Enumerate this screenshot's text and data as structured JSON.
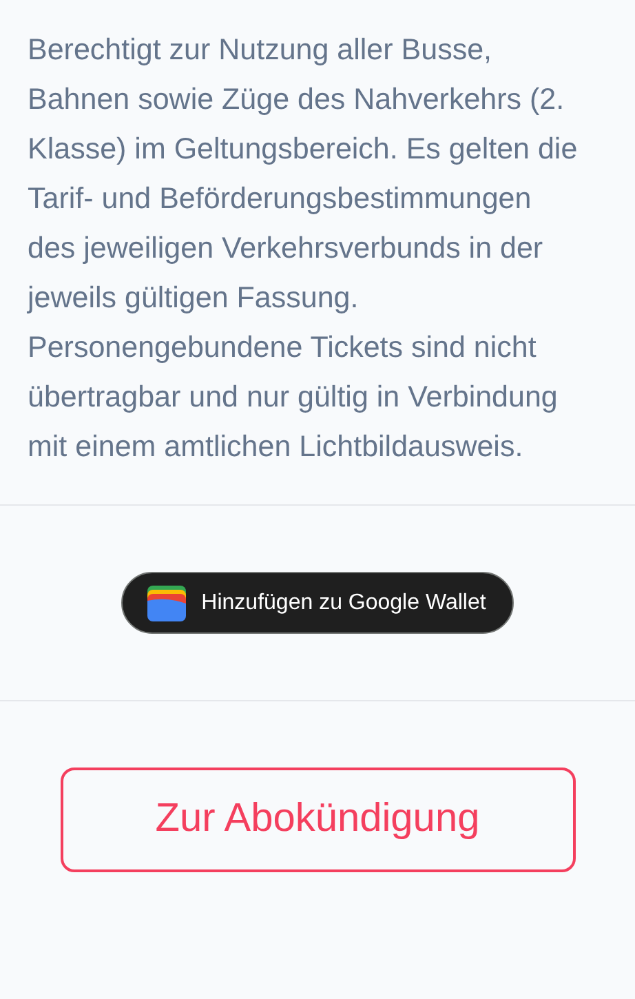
{
  "terms": {
    "text": "Berechtigt zur Nutzung aller Busse, Bahnen sowie Züge des Nahverkehrs (2. Klasse) im Geltungsbereich. Es gelten die Tarif- und Beförderungsbestimmungen des jeweiligen Verkehrsverbunds in der jeweils gültigen Fassung. Personengebundene Tickets sind nicht übertragbar und nur gültig in Verbindung mit einem amtlichen Lichtbildausweis."
  },
  "wallet_button": {
    "label": "Hinzufügen zu Google Wallet"
  },
  "cancel_button": {
    "label": "Zur Abokündigung"
  }
}
